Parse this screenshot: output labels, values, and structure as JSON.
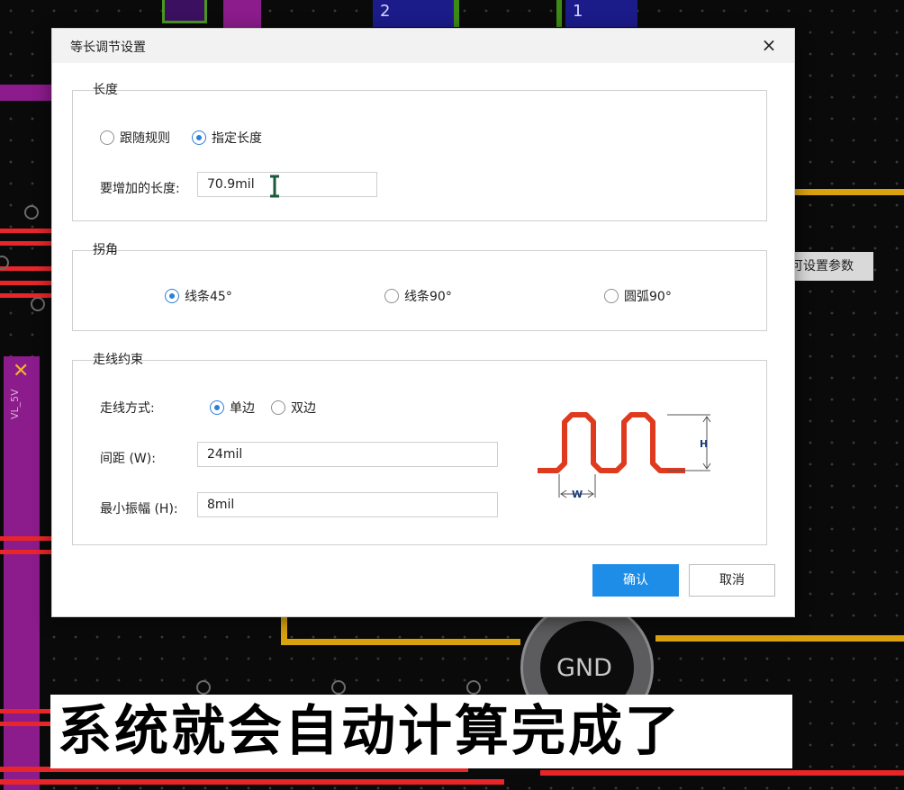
{
  "dialog": {
    "title": "等长调节设置",
    "close_glyph": "×",
    "length_group": {
      "title": "长度",
      "options": [
        "跟随规则",
        "指定长度"
      ],
      "selected": "指定长度",
      "add_length_label": "要增加的长度:",
      "add_length_value": "70.9mil"
    },
    "corner_group": {
      "title": "拐角",
      "options": [
        "线条45°",
        "线条90°",
        "圆弧90°"
      ],
      "selected": "线条45°"
    },
    "routing_group": {
      "title": "走线约束",
      "mode_label": "走线方式:",
      "mode_options": [
        "单边",
        "双边"
      ],
      "mode_selected": "单边",
      "spacing_label": "间距 (W):",
      "spacing_value": "24mil",
      "amplitude_label": "最小振幅 (H):",
      "amplitude_value": "8mil",
      "diagram_label_w": "W",
      "diagram_label_h": "H"
    },
    "ok_label": "确认",
    "cancel_label": "取消"
  },
  "background": {
    "tooltip": "可设置参数",
    "gnd_label": "GND",
    "comp_labels": [
      "2",
      "1",
      "VL_5V"
    ],
    "caption": "系统就会自动计算完成了"
  },
  "colors": {
    "accent": "#1e8de8",
    "radio_checked": "#2d7fd6",
    "trace_red": "#e8262a",
    "trace_yellow": "#d9a20e",
    "pcb_purple": "#8c1b8c",
    "diagram_red": "#e03a1e",
    "background": "#0a0a0a"
  }
}
